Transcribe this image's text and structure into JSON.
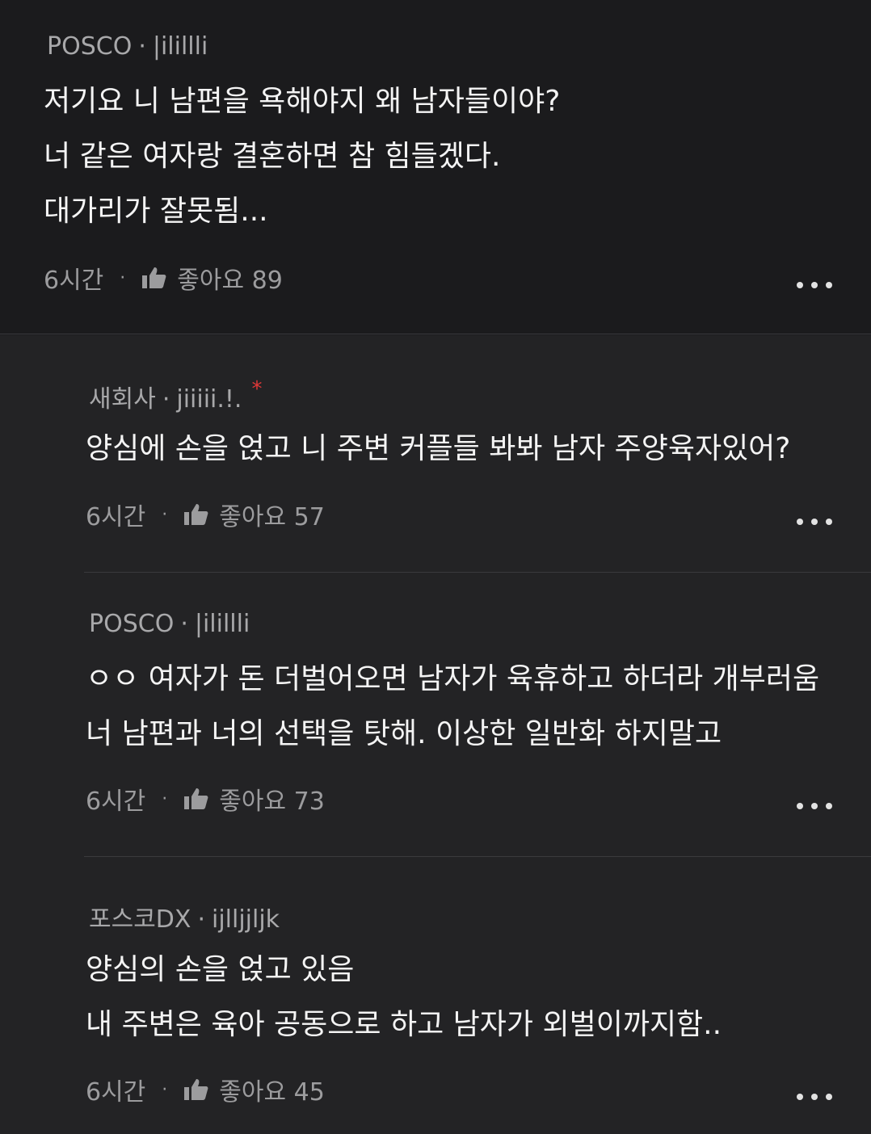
{
  "comments": [
    {
      "company": "POSCO",
      "separator": "·",
      "user": "|ilillli",
      "lines": [
        "저기요 니 남편을 욕해야지 왜 남자들이야?",
        "너 같은 여자랑 결혼하면 참 힘들겠다.",
        "대가리가 잘못됨..."
      ],
      "time": "6시간",
      "dot": "·",
      "like_label": "좋아요 89",
      "thumb_icon": "thumbs-up-icon",
      "more_icon": "more-horizontal-icon"
    },
    {
      "company": "새회사",
      "separator": "·",
      "user": "jiiiii.!.",
      "badge": "*",
      "lines": [
        "양심에 손을 얹고 니 주변 커플들 봐봐 남자 주양육자있어?"
      ],
      "time": "6시간",
      "dot": "·",
      "like_label": "좋아요 57",
      "thumb_icon": "thumbs-up-icon",
      "more_icon": "more-horizontal-icon"
    },
    {
      "company": "POSCO",
      "separator": "·",
      "user": "|ilillli",
      "lines": [
        "ㅇㅇ 여자가 돈 더벌어오면 남자가 육휴하고 하더라 개부러움",
        "너 남편과 너의 선택을 탓해. 이상한 일반화 하지말고"
      ],
      "time": "6시간",
      "dot": "·",
      "like_label": "좋아요 73",
      "thumb_icon": "thumbs-up-icon",
      "more_icon": "more-horizontal-icon"
    },
    {
      "company": "포스코DX",
      "separator": "·",
      "user": "ijlljjljk",
      "lines": [
        "양심의 손을 얹고 있음",
        "내 주변은 육아 공동으로 하고 남자가 외벌이까지함.."
      ],
      "time": "6시간",
      "dot": "·",
      "like_label": "좋아요 45",
      "thumb_icon": "thumbs-up-icon",
      "more_icon": "more-horizontal-icon"
    }
  ],
  "colors": {
    "background_top": "#1b1b1d",
    "background_replies": "#232325",
    "text": "#f4f4f4",
    "meta": "#a8a8aa",
    "badge": "#e03838"
  }
}
